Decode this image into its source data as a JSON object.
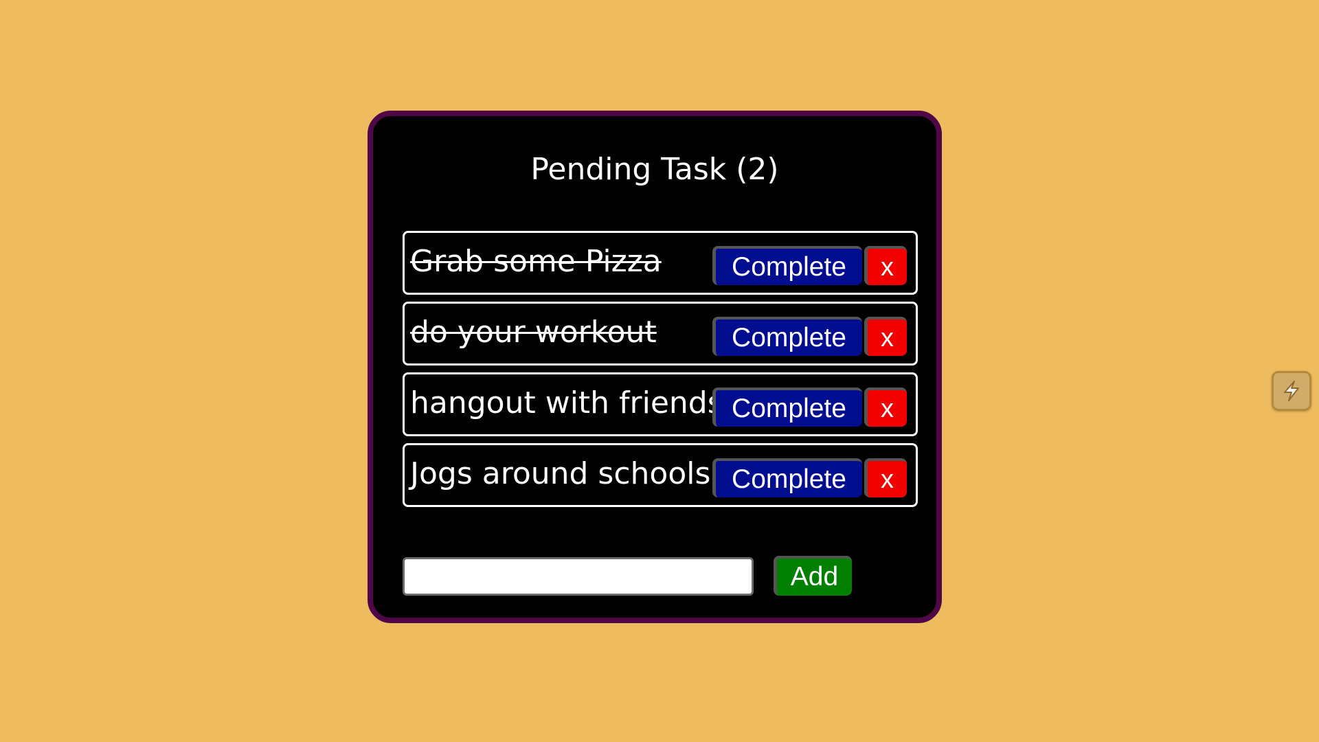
{
  "app": {
    "title": "Pending Task (2)"
  },
  "tasks": [
    {
      "text": "Grab some Pizza",
      "completed": true,
      "complete_label": "Complete",
      "delete_label": "x"
    },
    {
      "text": "do your workout",
      "completed": true,
      "complete_label": "Complete",
      "delete_label": "x"
    },
    {
      "text": "hangout with friends",
      "completed": false,
      "complete_label": "Complete",
      "delete_label": "x"
    },
    {
      "text": "Jogs around schools",
      "completed": false,
      "complete_label": "Complete",
      "delete_label": "x"
    }
  ],
  "composer": {
    "input_value": "",
    "input_placeholder": "",
    "add_label": "Add"
  },
  "widget": {
    "icon": "lightning-icon"
  },
  "colors": {
    "background": "#efbb5f",
    "card_background": "#000000",
    "card_border": "#4f0748",
    "complete_button": "#000d8f",
    "delete_button": "#f20000",
    "add_button": "#007f00"
  }
}
